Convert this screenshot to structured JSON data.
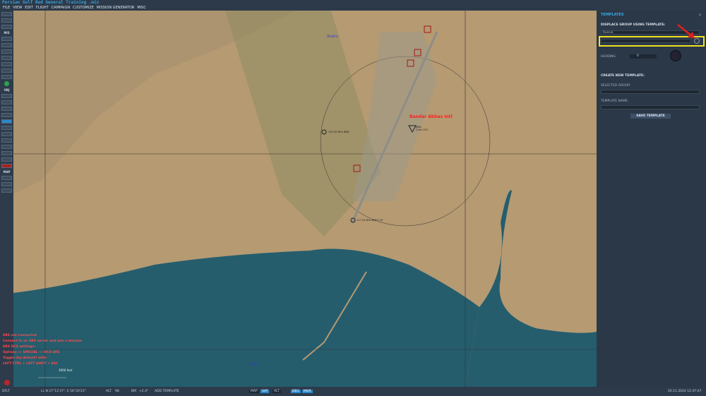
{
  "title": "Persian Gulf Red General Training .miz",
  "menu": [
    "FILE",
    "VIEW",
    "EDIT",
    "FLIGHT",
    "CAMPAIGN",
    "CUSTOMIZE",
    "MISSION GENERATOR",
    "MISC"
  ],
  "toolbar": {
    "mis_label": "MIS",
    "obj_label": "OBJ",
    "map_label": "MAP"
  },
  "map": {
    "town_label": "Shahu",
    "airport_label": "Bandar Abbas Intl",
    "ndb_label": "BND\nChan 103",
    "vor1_label": "230 00 MHz BND",
    "vor2_label": "117.20 MHz BND 119",
    "scale_label": "3000 feet",
    "water_label": "LHXG",
    "colors": {
      "land": "#b59a72",
      "sea": "#255d6d",
      "airport_text": "#ff2020"
    }
  },
  "srs": [
    "SRS not connected",
    "Connect to an SRS server and join a mission",
    "SRS DCS settings:",
    "Options -> SPECIAL -> DCS-SRS",
    "Toggle (by default) with:",
    "LEFT CTRL + LEFT SHIFT + ESC"
  ],
  "panel": {
    "title": "TEMPLATES",
    "close": "×",
    "displace_heading": "DISPLACE GROUP USING TEMPLATE:",
    "country_value": "Russia",
    "template_value": "",
    "heading_label": "HEADING",
    "heading_value": "0",
    "create_heading": "CREATE NEW TEMPLATE:",
    "selected_group_label": "SELECTED GROUP:",
    "selected_group_value": "",
    "template_name_label": "TEMPLATE NAME:",
    "template_name_value": "",
    "save_button": "SAVE TEMPLATE"
  },
  "status": {
    "mode": "DFLT",
    "coords": "LL  N 27°12'37\", E 56°20'23\"",
    "alt_label": "ALT",
    "alt_value": "98",
    "bm_label": "BM",
    "bm_value": "+2.4°",
    "add_template": "ADD TEMPLATE",
    "map_btn": "MAP",
    "sat_btn": "SAT",
    "alt_btn": "ALT",
    "btn1": "DEG",
    "btn2": "MGR",
    "datetime": "20.11.2024 12:47:47"
  }
}
